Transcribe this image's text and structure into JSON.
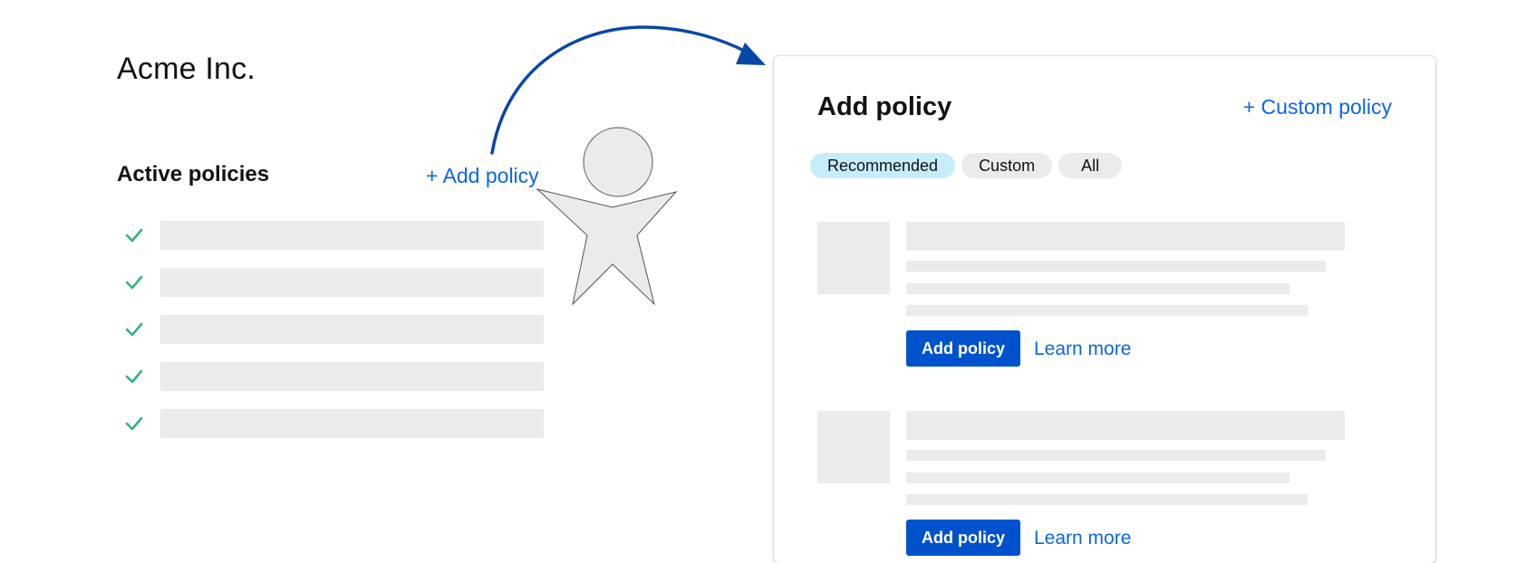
{
  "org": {
    "title": "Acme Inc."
  },
  "active_policies": {
    "heading": "Active policies",
    "add_link": "+ Add policy",
    "rows": [
      {
        "checked": true
      },
      {
        "checked": true
      },
      {
        "checked": true
      },
      {
        "checked": true
      },
      {
        "checked": true
      }
    ],
    "check_color": "#36b37e"
  },
  "panel": {
    "title": "Add policy",
    "custom_link": "+ Custom policy",
    "filters": [
      {
        "label": "Recommended",
        "active": true
      },
      {
        "label": "Custom",
        "active": false
      },
      {
        "label": "All",
        "active": false
      }
    ],
    "cards": [
      {
        "button_label": "Add policy",
        "link_label": "Learn more"
      },
      {
        "button_label": "Add policy",
        "link_label": "Learn more"
      }
    ]
  },
  "colors": {
    "link": "#0c66e4",
    "primary_button": "#0052cc",
    "chip_active": "#c6edfb",
    "placeholder": "#ebebeb",
    "arrow": "#0747a6"
  },
  "icons": {
    "check": "check-icon",
    "arrow": "curved-arrow",
    "figure": "person-figure"
  }
}
